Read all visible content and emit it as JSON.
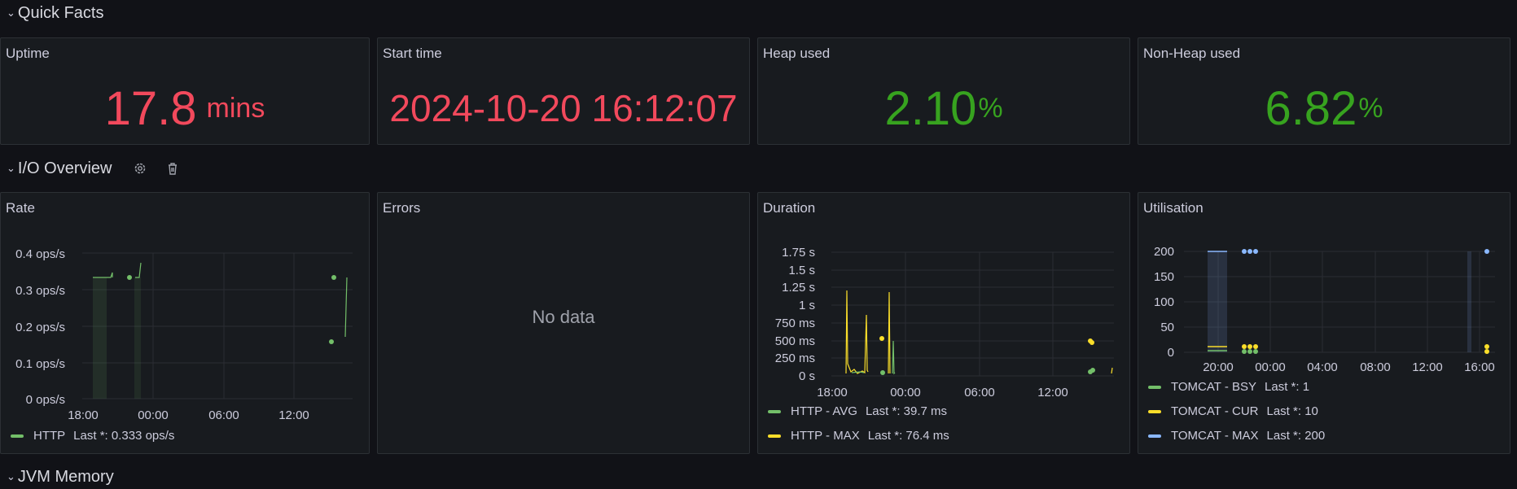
{
  "rows": {
    "quick_facts": "Quick Facts",
    "io_overview": "I/O Overview",
    "jvm_memory": "JVM Memory"
  },
  "stats": {
    "uptime": {
      "title": "Uptime",
      "value": "17.8",
      "unit": "mins",
      "color": "#f2495c"
    },
    "start_time": {
      "title": "Start time",
      "value": "2024-10-20 16:12:07",
      "color": "#f2495c"
    },
    "heap_used": {
      "title": "Heap used",
      "value": "2.10",
      "unit": "%",
      "color": "#37a31f"
    },
    "non_heap_used": {
      "title": "Non-Heap used",
      "value": "6.82",
      "unit": "%",
      "color": "#37a31f"
    }
  },
  "panels": {
    "rate": {
      "title": "Rate",
      "y_ticks": [
        "0.4 ops/s",
        "0.3 ops/s",
        "0.2 ops/s",
        "0.1 ops/s",
        "0 ops/s"
      ],
      "x_ticks": [
        "18:00",
        "00:00",
        "06:00",
        "12:00"
      ],
      "legend": [
        {
          "name": "HTTP",
          "last": "Last *: 0.333 ops/s",
          "color": "#73bf69"
        }
      ]
    },
    "errors": {
      "title": "Errors",
      "empty": "No data"
    },
    "duration": {
      "title": "Duration",
      "y_ticks": [
        "1.75 s",
        "1.5 s",
        "1.25 s",
        "1 s",
        "750 ms",
        "500 ms",
        "250 ms",
        "0 s"
      ],
      "x_ticks": [
        "18:00",
        "00:00",
        "06:00",
        "12:00"
      ],
      "legend": [
        {
          "name": "HTTP - AVG",
          "last": "Last *: 39.7 ms",
          "color": "#73bf69"
        },
        {
          "name": "HTTP - MAX",
          "last": "Last *: 76.4 ms",
          "color": "#fade2a"
        }
      ]
    },
    "utilisation": {
      "title": "Utilisation",
      "y_ticks": [
        "200",
        "150",
        "100",
        "50",
        "0"
      ],
      "x_ticks": [
        "20:00",
        "00:00",
        "04:00",
        "08:00",
        "12:00",
        "16:00"
      ],
      "legend": [
        {
          "name": "TOMCAT - BSY",
          "last": "Last *: 1",
          "color": "#73bf69"
        },
        {
          "name": "TOMCAT - CUR",
          "last": "Last *: 10",
          "color": "#fade2a"
        },
        {
          "name": "TOMCAT - MAX",
          "last": "Last *: 200",
          "color": "#8ab8ff"
        }
      ]
    }
  },
  "icons": {
    "gear": "gear-icon",
    "trash": "trash-icon",
    "chevron": "chevron-down-icon"
  }
}
